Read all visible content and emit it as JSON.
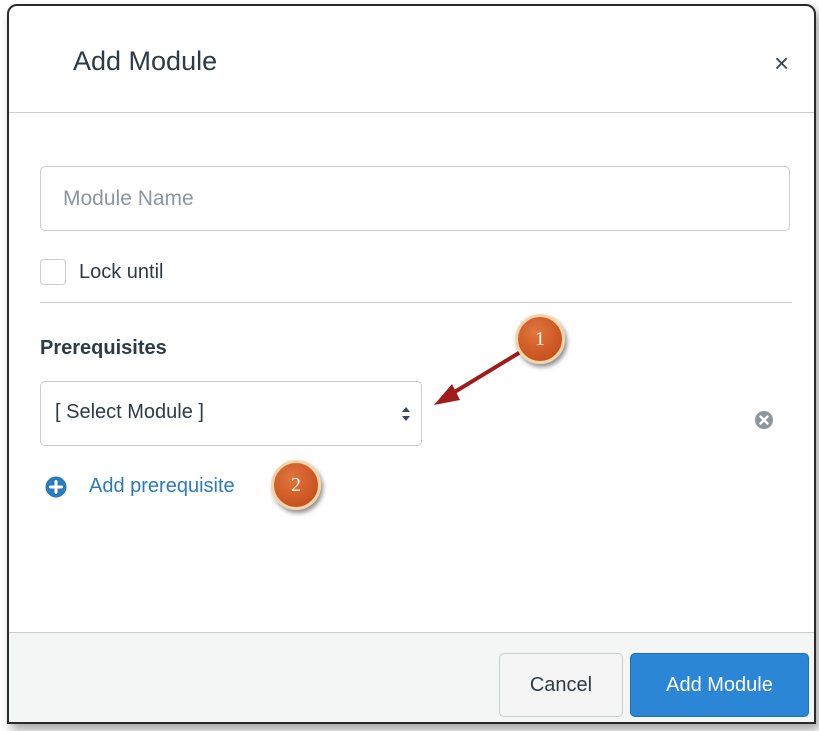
{
  "dialog": {
    "title": "Add Module",
    "close_symbol": "×"
  },
  "form": {
    "module_name_placeholder": "Module Name",
    "module_name_value": "",
    "lock_until_label": "Lock until",
    "prerequisites_heading": "Prerequisites",
    "select_value": "[ Select Module ]",
    "add_prerequisite_label": "Add prerequisite"
  },
  "footer": {
    "cancel_label": "Cancel",
    "submit_label": "Add Module"
  },
  "callouts": {
    "badge_1": "1",
    "badge_2": "2"
  },
  "icons": {
    "close": "close-icon",
    "select_arrows": "sort-arrows-icon",
    "remove": "remove-circle-icon",
    "add": "plus-circle-icon"
  },
  "colors": {
    "link": "#2b7abc",
    "primary_button": "#2b86d6",
    "callout_badge": "#c9531f",
    "callout_arrow": "#a01b1b"
  }
}
